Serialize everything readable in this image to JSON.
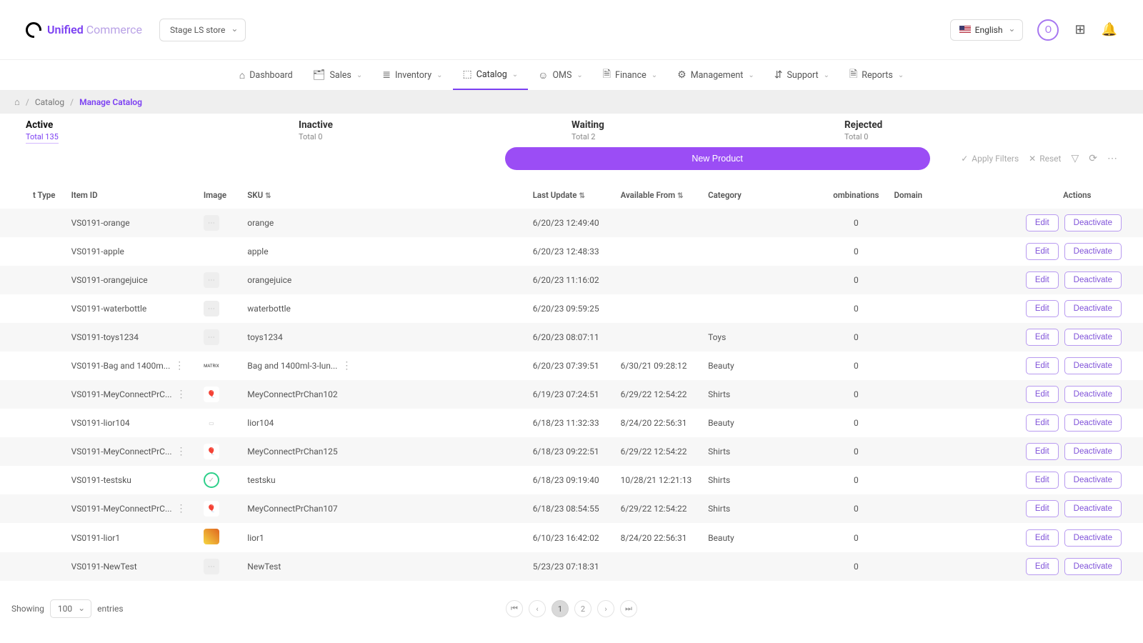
{
  "brand": {
    "part1": "Unified",
    "part2": "Commerce"
  },
  "store_selector": {
    "label": "Stage LS store"
  },
  "lang": {
    "label": "English"
  },
  "avatar_initial": "O",
  "nav": [
    {
      "label": "Dashboard",
      "icon": "⌂"
    },
    {
      "label": "Sales",
      "icon": "🗂",
      "chev": true
    },
    {
      "label": "Inventory",
      "icon": "≣",
      "chev": true
    },
    {
      "label": "Catalog",
      "icon": "⬚",
      "chev": true,
      "active": true
    },
    {
      "label": "OMS",
      "icon": "☺",
      "chev": true
    },
    {
      "label": "Finance",
      "icon": "🗎",
      "chev": true
    },
    {
      "label": "Management",
      "icon": "⚙",
      "chev": true
    },
    {
      "label": "Support",
      "icon": "⇵",
      "chev": true
    },
    {
      "label": "Reports",
      "icon": "🗎",
      "chev": true
    }
  ],
  "breadcrumb": {
    "items": [
      "Catalog"
    ],
    "current": "Manage Catalog"
  },
  "status_tabs": [
    {
      "title": "Active",
      "sub": "Total 135",
      "active": true
    },
    {
      "title": "Inactive",
      "sub": "Total 0"
    },
    {
      "title": "Waiting",
      "sub": "Total 2"
    },
    {
      "title": "Rejected",
      "sub": "Total 0"
    }
  ],
  "buttons": {
    "new_product": "New Product",
    "apply_filters": "Apply Filters",
    "reset": "Reset",
    "edit": "Edit",
    "deactivate": "Deactivate"
  },
  "columns": {
    "type": "t Type",
    "item_id": "Item ID",
    "image": "Image",
    "sku": "SKU",
    "last_update": "Last Update",
    "available_from": "Available From",
    "category": "Category",
    "combinations": "ombinations",
    "domain": "Domain",
    "actions": "Actions"
  },
  "rows": [
    {
      "item_id": "VS0191-orange",
      "sku": "orange",
      "last_update": "6/20/23 12:49:40",
      "available_from": "",
      "category": "",
      "comb": "0",
      "img": "ph"
    },
    {
      "item_id": "VS0191-apple",
      "sku": "apple",
      "last_update": "6/20/23 12:48:33",
      "available_from": "",
      "category": "",
      "comb": "0",
      "img": ""
    },
    {
      "item_id": "VS0191-orangejuice",
      "sku": "orangejuice",
      "last_update": "6/20/23 11:16:02",
      "available_from": "",
      "category": "",
      "comb": "0",
      "img": "ph"
    },
    {
      "item_id": "VS0191-waterbottle",
      "sku": "waterbottle",
      "last_update": "6/20/23 09:59:25",
      "available_from": "",
      "category": "",
      "comb": "0",
      "img": "ph"
    },
    {
      "item_id": "VS0191-toys1234",
      "sku": "toys1234",
      "last_update": "6/20/23 08:07:11",
      "available_from": "",
      "category": "Toys",
      "comb": "0",
      "img": "ph"
    },
    {
      "item_id": "VS0191-Bag and 1400m...",
      "sku": "Bag and 1400ml-3-lun...",
      "last_update": "6/20/23 07:39:51",
      "available_from": "6/30/21 09:28:12",
      "category": "Beauty",
      "comb": "0",
      "img": "tx",
      "dots": true,
      "skudots": true
    },
    {
      "item_id": "VS0191-MeyConnectPrC...",
      "sku": "MeyConnectPrChan102",
      "last_update": "6/19/23 07:24:51",
      "available_from": "6/29/22 12:54:22",
      "category": "Shirts",
      "comb": "0",
      "img": "emo",
      "dots": true
    },
    {
      "item_id": "VS0191-lior104",
      "sku": "lior104",
      "last_update": "6/18/23 11:32:33",
      "available_from": "8/24/20 22:56:31",
      "category": "Beauty",
      "comb": "0",
      "img": "gr"
    },
    {
      "item_id": "VS0191-MeyConnectPrC...",
      "sku": "MeyConnectPrChan125",
      "last_update": "6/18/23 09:22:51",
      "available_from": "6/29/22 12:54:22",
      "category": "Shirts",
      "comb": "0",
      "img": "emo",
      "dots": true
    },
    {
      "item_id": "VS0191-testsku",
      "sku": "testsku",
      "last_update": "6/18/23 09:19:40",
      "available_from": "10/28/21 12:21:13",
      "category": "Shirts",
      "comb": "0",
      "img": "green"
    },
    {
      "item_id": "VS0191-MeyConnectPrC...",
      "sku": "MeyConnectPrChan107",
      "last_update": "6/18/23 08:54:55",
      "available_from": "6/29/22 12:54:22",
      "category": "Shirts",
      "comb": "0",
      "img": "emo",
      "dots": true
    },
    {
      "item_id": "VS0191-lior1",
      "sku": "lior1",
      "last_update": "6/10/23 16:42:02",
      "available_from": "8/24/20 22:56:31",
      "category": "Beauty",
      "comb": "0",
      "img": "col"
    },
    {
      "item_id": "VS0191-NewTest",
      "sku": "NewTest",
      "last_update": "5/23/23 07:18:31",
      "available_from": "",
      "category": "",
      "comb": "0",
      "img": "ph"
    }
  ],
  "footer": {
    "showing": "Showing",
    "entries": "entries",
    "pagesize": "100",
    "pages": [
      "1",
      "2"
    ],
    "active_page": "1"
  }
}
